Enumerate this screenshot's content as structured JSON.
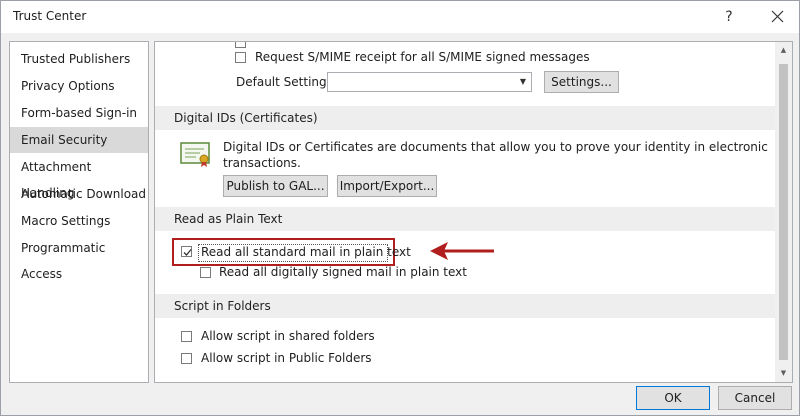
{
  "window": {
    "title": "Trust Center",
    "help_glyph": "?"
  },
  "nav": {
    "items": [
      {
        "label": "Trusted Publishers"
      },
      {
        "label": "Privacy Options"
      },
      {
        "label": "Form-based Sign-in"
      },
      {
        "label": "Email Security"
      },
      {
        "label": "Attachment Handling"
      },
      {
        "label": "Automatic Download"
      },
      {
        "label": "Macro Settings"
      },
      {
        "label": "Programmatic Access"
      }
    ],
    "active": "Email Security"
  },
  "encrypted": {
    "smime_receipt_label": "Request S/MIME receipt for all S/MIME signed messages",
    "default_setting_label": "Default Setting:",
    "default_setting_value": "",
    "settings_button": "Settings..."
  },
  "digital_ids": {
    "header": "Digital IDs (Certificates)",
    "description_line1": "Digital IDs or Certificates are documents that allow you to prove your identity in electronic",
    "description_line2": "transactions.",
    "publish_button": "Publish to GAL...",
    "import_export_button": "Import/Export..."
  },
  "plain_text": {
    "header": "Read as Plain Text",
    "read_all_label": "Read all standard mail in plain text",
    "read_all_checked": true,
    "read_signed_label": "Read all digitally signed mail in plain text",
    "read_signed_checked": false
  },
  "script_folders": {
    "header": "Script in Folders",
    "shared_label": "Allow script in shared folders",
    "shared_checked": false,
    "public_label": "Allow script in Public Folders",
    "public_checked": false
  },
  "footer": {
    "ok": "OK",
    "cancel": "Cancel"
  },
  "colors": {
    "annotation_red": "#b01e1e",
    "selected_nav": "#d9d9d9",
    "section_header": "#eeeeee"
  }
}
